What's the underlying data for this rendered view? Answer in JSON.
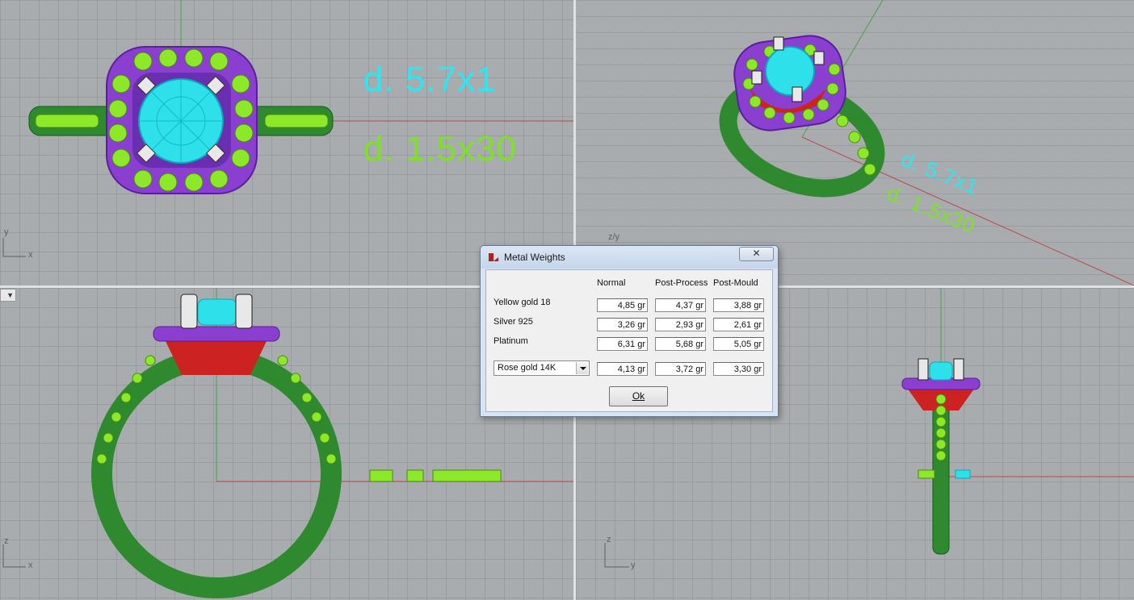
{
  "viewports": {
    "top": {
      "axis_y": "y",
      "axis_x": "x",
      "dim_stone": "d. 5.7x1",
      "dim_pave": "d. 1.5x30"
    },
    "perspective": {
      "axis_label": "z/y",
      "dim_stone": "d. 5.7x1",
      "dim_pave": "d. 1.5x30"
    },
    "front": {
      "axis_z": "z",
      "axis_x": "x",
      "menu_arrow": "▼"
    },
    "right": {
      "axis_z": "z",
      "axis_y": "y"
    }
  },
  "dialog": {
    "title": "Metal Weights",
    "close_glyph": "✕",
    "columns": [
      "Normal",
      "Post-Process",
      "Post-Mould"
    ],
    "rows": [
      {
        "metal": "Yellow gold 18",
        "values": [
          "4,85 gr",
          "4,37 gr",
          "3,88 gr"
        ]
      },
      {
        "metal": "Silver 925",
        "values": [
          "3,26 gr",
          "2,93 gr",
          "2,61 gr"
        ]
      },
      {
        "metal": "Platinum",
        "values": [
          "6,31 gr",
          "5,68 gr",
          "5,05 gr"
        ]
      }
    ],
    "custom_row": {
      "selected_metal": "Rose gold 14K",
      "values": [
        "4,13 gr",
        "3,72 gr",
        "3,30 gr"
      ]
    },
    "ok_label": "Ok"
  },
  "colors": {
    "shank": "#2f8a2f",
    "halo": "#8a3fd0",
    "center_stone": "#2ee0ea",
    "pave_stones": "#8ee82a",
    "basket": "#cc2222",
    "prongs": "#e8e8e8",
    "dim_stone_text": "#2ee6ef",
    "dim_pave_text": "#7ee02a",
    "axis_red": "#b84a4a",
    "axis_green": "#4aa04a"
  }
}
